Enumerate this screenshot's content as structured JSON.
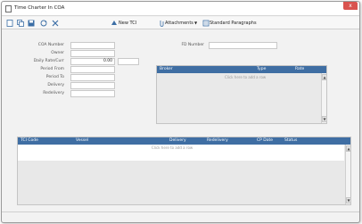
{
  "window": {
    "title": "Time Charter In COA",
    "close_label": "x"
  },
  "toolbar": {
    "icons": [
      "new-document-icon",
      "copy-icon",
      "save-icon",
      "refresh-icon",
      "delete-icon"
    ],
    "new_tci_label": "New TCI",
    "attachments_label": "Attachments",
    "standard_paragraphs_label": "Standard Paragraphs"
  },
  "form": {
    "coa_number_label": "COA Number",
    "owner_label": "Owner",
    "daily_rate_label": "Daily Rate/Curr",
    "daily_rate_value": "0.00",
    "period_from_label": "Period From",
    "period_to_label": "Period To",
    "delivery_label": "Delivery",
    "redelivery_label": "Redelivery",
    "fd_number_label": "FD Number"
  },
  "broker_grid": {
    "columns": [
      "Broker",
      "Type",
      "Rate"
    ],
    "empty_text": "Click here to add a row"
  },
  "tci_grid": {
    "columns": [
      "TCI Code",
      "Vessel",
      "Delivery",
      "Redelivery",
      "CP Date",
      "Status"
    ],
    "empty_text": "Click here to add a row"
  },
  "colors": {
    "grid_header": "#3f6ea3",
    "close": "#d9534f"
  }
}
